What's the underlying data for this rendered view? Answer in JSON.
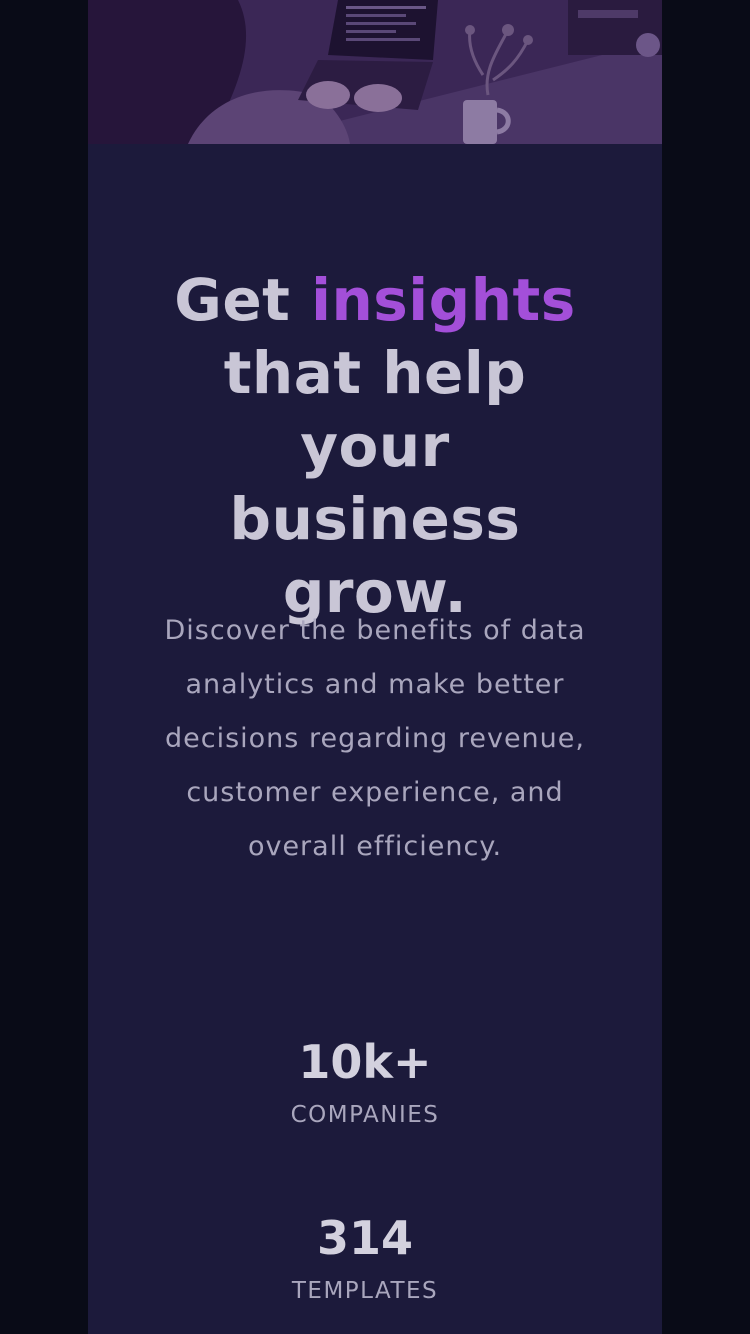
{
  "hero": {
    "image_label": "person-working-on-laptop-photo"
  },
  "headline": {
    "prefix": "Get ",
    "accent": "insights",
    "suffix": " that help your business grow."
  },
  "description": "Discover the benefits of data analytics and make better decisions regarding revenue, customer experience, and overall efficiency.",
  "stats": [
    {
      "value": "10k+",
      "label": "COMPANIES"
    },
    {
      "value": "314",
      "label": "TEMPLATES"
    }
  ],
  "colors": {
    "page_background": "#090b17",
    "card_background": "#1c1a3b",
    "accent": "#a34fd9",
    "heading_text": "#c9c6d6",
    "body_text": "#a9a6bd",
    "image_tint": "#3a2654"
  }
}
